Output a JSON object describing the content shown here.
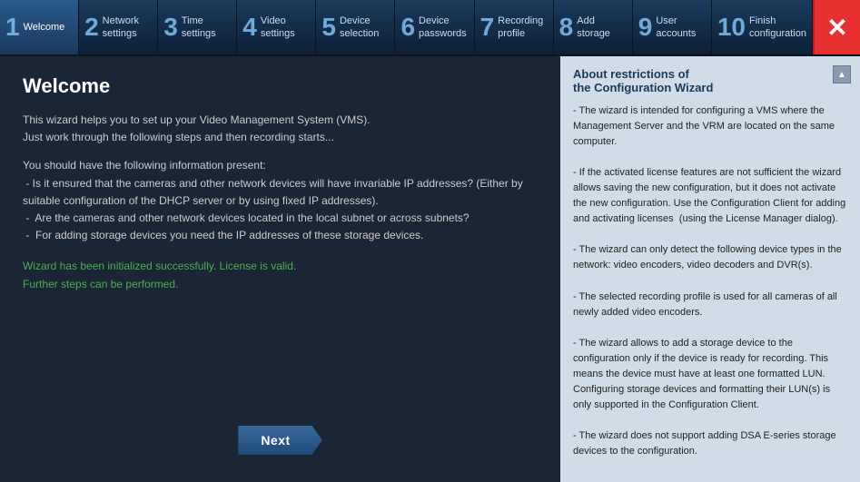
{
  "nav": {
    "items": [
      {
        "number": "1",
        "label": "Welcome",
        "active": true
      },
      {
        "number": "2",
        "label": "Network\nsettings",
        "active": false
      },
      {
        "number": "3",
        "label": "Time\nsettings",
        "active": false
      },
      {
        "number": "4",
        "label": "Video\nsettings",
        "active": false
      },
      {
        "number": "5",
        "label": "Device\nselection",
        "active": false
      },
      {
        "number": "6",
        "label": "Device\npasswords",
        "active": false
      },
      {
        "number": "7",
        "label": "Recording\nprofile",
        "active": false
      },
      {
        "number": "8",
        "label": "Add\nstorage",
        "active": false
      },
      {
        "number": "9",
        "label": "User\naccounts",
        "active": false
      },
      {
        "number": "10",
        "label": "Finish\nconfiguration",
        "active": false
      }
    ],
    "close_label": "×"
  },
  "welcome": {
    "title": "Welcome",
    "paragraph1": "This wizard helps you to set up your Video Management System (VMS).\nJust work through the following steps and then recording starts...",
    "paragraph2": "You should have the following information present:\n - Is it ensured that the cameras and other network devices will have invariable IP addresses? (Either by suitable configuration of the DHCP server or by using fixed IP addresses).\n -  Are the cameras and other network devices located in the local subnet or across subnets?\n -  For adding storage devices you need the IP addresses of these storage devices.",
    "success_text": "Wizard has been initialized successfully. License is valid.\nFurther steps can be performed."
  },
  "buttons": {
    "next": "Next"
  },
  "restrictions_panel": {
    "title": "About restrictions of\nthe Configuration Wizard",
    "text": "- The wizard is intended for configuring a VMS where the Management Server and the VRM are located on the same computer.\n- If the activated license features are not sufficient the wizard allows saving the new configuration, but it does not activate the new configuration. Use the Configuration Client for adding and activating licenses  (using the License Manager dialog).\n- The wizard can only detect the following device types in the network: video encoders, video decoders and DVR(s).\n- The selected recording profile is used for all cameras of all newly added video encoders.\n- The wizard allows to add a storage device to the configuration only if the device is ready for recording. This means the device must have at least one formatted LUN. Configuring storage devices and formatting their LUN(s) is only supported in the Configuration Client.\n- The wizard does not support adding DSA E-series storage devices to the configuration."
  }
}
